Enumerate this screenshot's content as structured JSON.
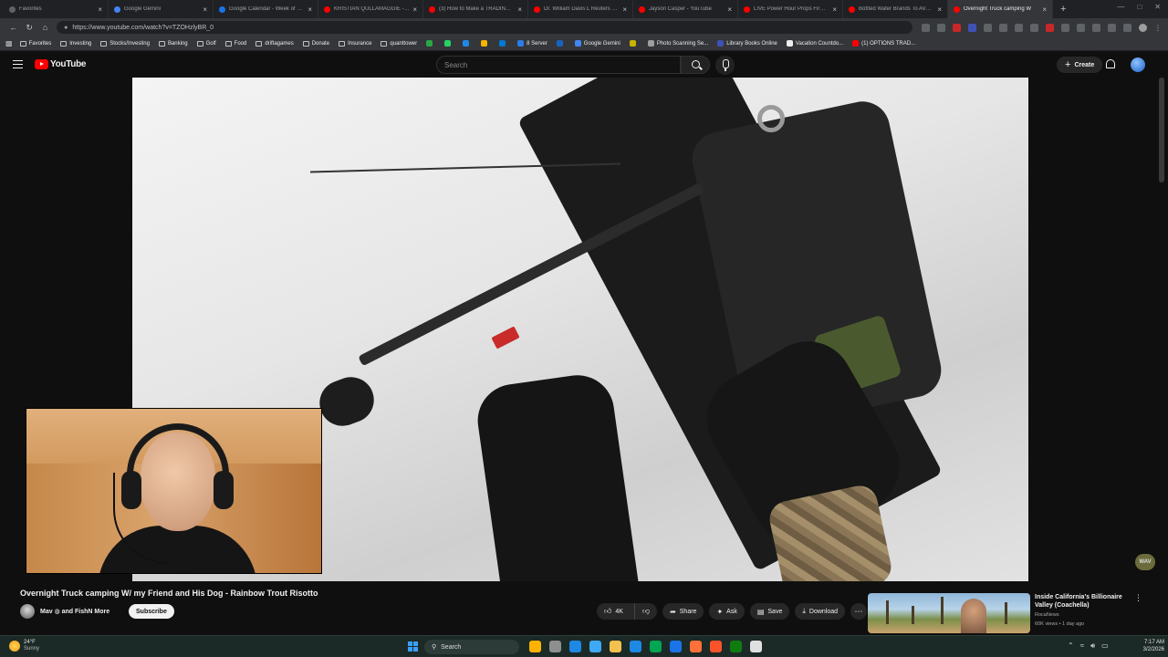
{
  "browser": {
    "tabs": [
      {
        "title": "Favorites",
        "color": "#5f6368",
        "active": false
      },
      {
        "title": "Google Gemini",
        "color": "#4285f4",
        "active": false
      },
      {
        "title": "Google Calendar - Week of Marc",
        "color": "#1a73e8",
        "active": false
      },
      {
        "title": "KRISTIAN QULLAMAGGIE - Mul",
        "color": "#ff0000",
        "active": false
      },
      {
        "title": "(3) How to Make a TRADING Pl",
        "color": "#ff0000",
        "active": false
      },
      {
        "title": "Dr. William Davis L Reuters You",
        "color": "#ff0000",
        "active": false
      },
      {
        "title": "Jayson Casper - YouTube",
        "color": "#ff0000",
        "active": false
      },
      {
        "title": "LIVE Power Hour Props Firm Tra",
        "color": "#ff0000",
        "active": false
      },
      {
        "title": "Bottled Water Brands To AVOID",
        "color": "#ff0000",
        "active": false
      },
      {
        "title": "Overnight Truck camping W",
        "color": "#ff0000",
        "active": true
      }
    ],
    "new_tab": "+",
    "url": "https://www.youtube.com/watch?v=TZOHzlyBR_0",
    "bookmarks": [
      {
        "label": "Favorites",
        "type": "folder"
      },
      {
        "label": "Investing",
        "type": "folder"
      },
      {
        "label": "Stocks/Investing",
        "type": "folder"
      },
      {
        "label": "Banking",
        "type": "folder"
      },
      {
        "label": "Golf",
        "type": "folder"
      },
      {
        "label": "Food",
        "type": "folder"
      },
      {
        "label": "driftagames",
        "type": "folder"
      },
      {
        "label": "Donate",
        "type": "folder"
      },
      {
        "label": "Insurance",
        "type": "folder"
      },
      {
        "label": "quanttower",
        "type": "folder"
      },
      {
        "label": "",
        "type": "site",
        "color": "#2aa745"
      },
      {
        "label": "",
        "type": "site",
        "color": "#25d366"
      },
      {
        "label": "",
        "type": "site",
        "color": "#1e88e5"
      },
      {
        "label": "",
        "type": "site",
        "color": "#f4b400"
      },
      {
        "label": "",
        "type": "site",
        "color": "#0078d4"
      },
      {
        "label": "8 Server",
        "type": "site",
        "color": "#2b7de9"
      },
      {
        "label": "",
        "type": "site",
        "color": "#1565c0"
      },
      {
        "label": "Google Gemini",
        "type": "site",
        "color": "#4285f4"
      },
      {
        "label": "",
        "type": "site",
        "color": "#c8b400"
      },
      {
        "label": "Photo Scanning Se...",
        "type": "site",
        "color": "#9e9e9e"
      },
      {
        "label": "Library Books Online",
        "type": "site",
        "color": "#3f51b5"
      },
      {
        "label": "Vacation Countdo...",
        "type": "site",
        "color": "#eeeeee"
      },
      {
        "label": "(1) OPTIONS TRAD...",
        "type": "site",
        "color": "#ff0000"
      }
    ]
  },
  "youtube": {
    "logo_text": "YouTube",
    "search_placeholder": "Search",
    "create_label": "Create"
  },
  "video": {
    "title": "Overnight Truck camping W/ my Friend and His Dog - Rainbow Trout Risotto",
    "channel": "Mav ◍ and FishN More",
    "subscribe": "Subscribe",
    "likes": "4K",
    "share": "Share",
    "ask": "Ask",
    "save": "Save",
    "download": "Download"
  },
  "recommendation": {
    "title": "Inside California's Billionaire Valley (Coachella)",
    "channel": "RocaNews",
    "meta": "60K views • 1 day ago"
  },
  "side_badge": "WAV",
  "taskbar": {
    "temp": "24°F",
    "weather": "Sunny",
    "search": "Search",
    "time": "7:17 AM",
    "date": "3/2/2026",
    "app_colors": [
      "#ffb300",
      "#8f8f8f",
      "#1e88e5",
      "#3fa9f5",
      "#f2c14e",
      "#1e88e5",
      "#00a651",
      "#1a73e8",
      "#ff7139",
      "#fb542b",
      "#107c10",
      "#e0e0e0"
    ]
  }
}
